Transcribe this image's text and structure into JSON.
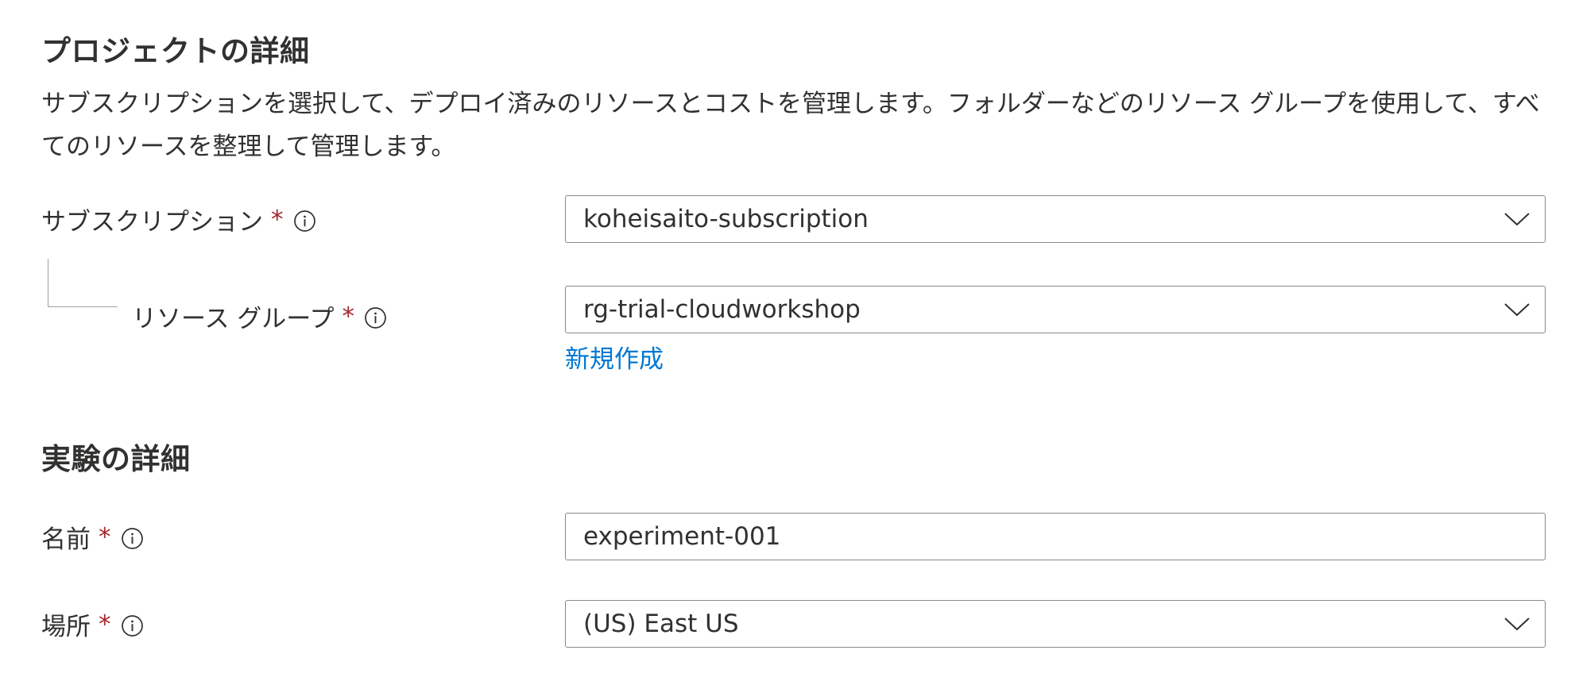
{
  "project": {
    "title": "プロジェクトの詳細",
    "description": "サブスクリプションを選択して、デプロイ済みのリソースとコストを管理します。フォルダーなどのリソース グループを使用して、すべてのリソースを整理して管理します。",
    "subscription": {
      "label": "サブスクリプション",
      "required": "*",
      "value": "koheisaito-subscription"
    },
    "resource_group": {
      "label": "リソース グループ",
      "required": "*",
      "value": "rg-trial-cloudworkshop",
      "create_new_link": "新規作成"
    }
  },
  "experiment": {
    "title": "実験の詳細",
    "name": {
      "label": "名前",
      "required": "*",
      "value": "experiment-001"
    },
    "location": {
      "label": "場所",
      "required": "*",
      "value": "(US) East US"
    }
  },
  "icons": {
    "info": "info-icon",
    "dropdown": "chevron-down-icon"
  },
  "colors": {
    "required": "#a4262c",
    "link": "#0078d4",
    "text": "#323130",
    "border": "#8a8886"
  }
}
